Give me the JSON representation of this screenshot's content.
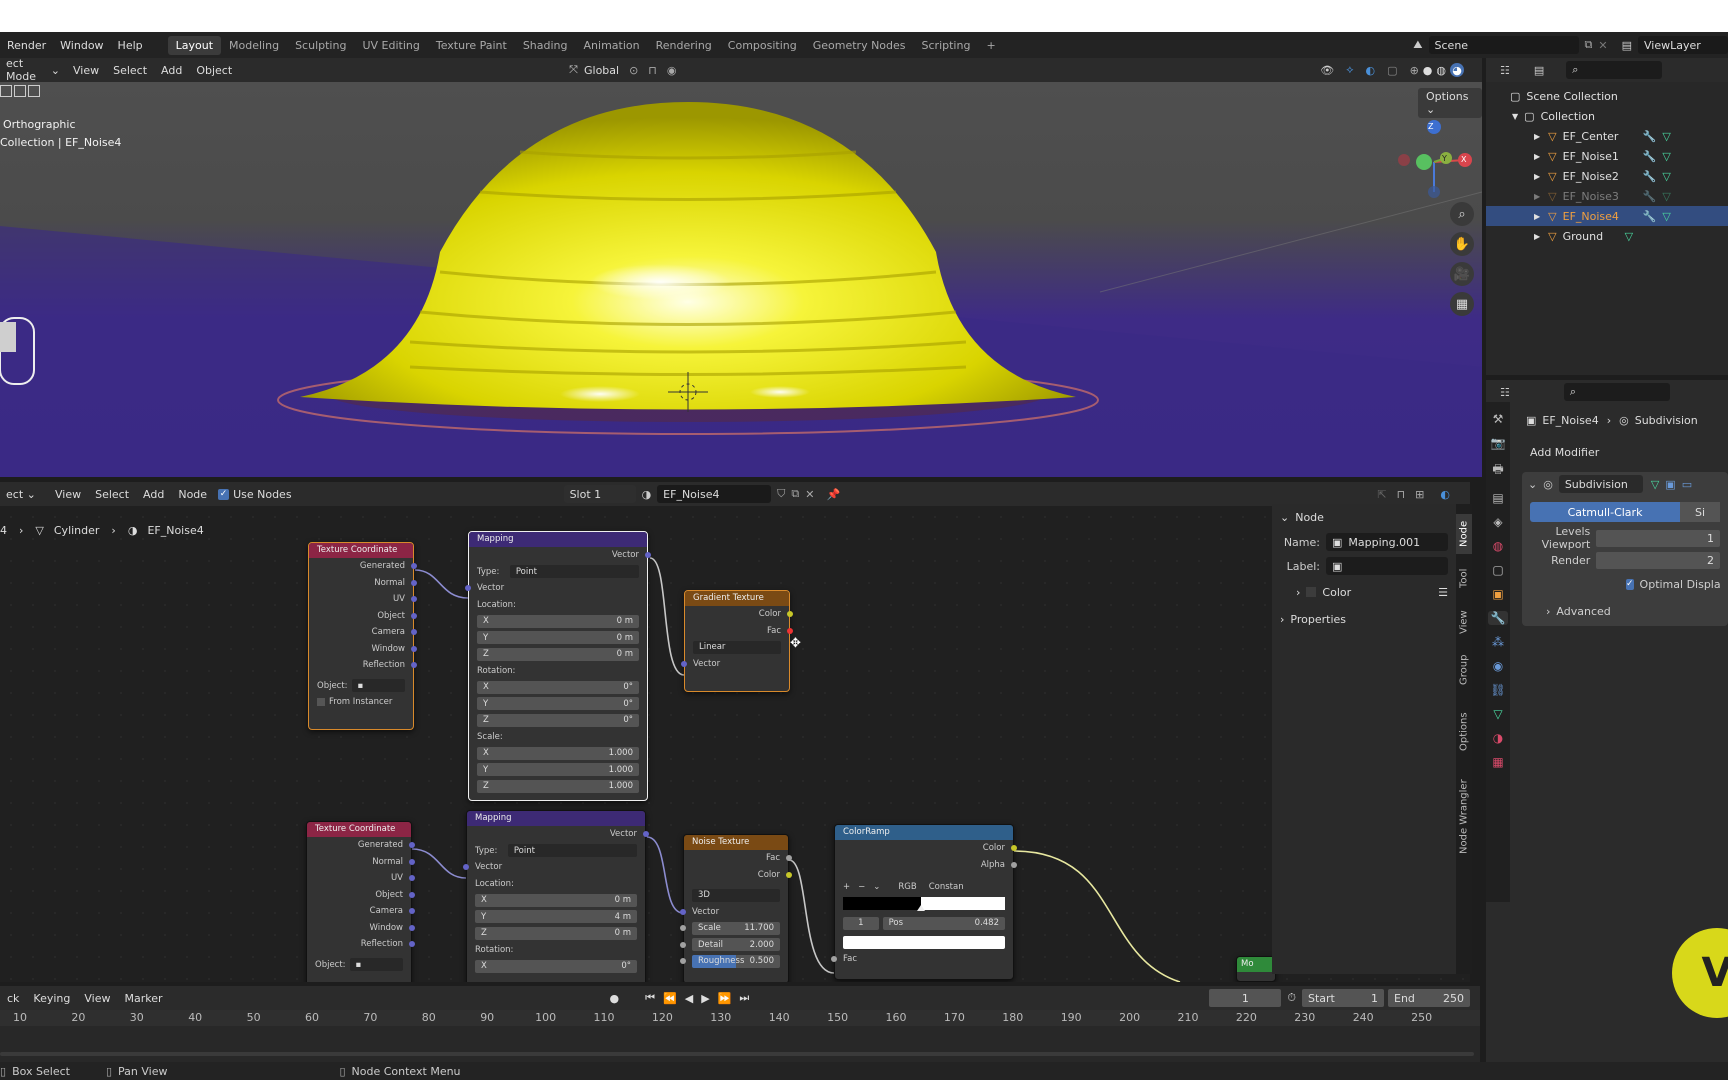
{
  "menu": {
    "items": [
      "Render",
      "Window",
      "Help"
    ],
    "workspaces": [
      "Layout",
      "Modeling",
      "Sculpting",
      "UV Editing",
      "Texture Paint",
      "Shading",
      "Animation",
      "Rendering",
      "Compositing",
      "Geometry Nodes",
      "Scripting"
    ],
    "add_ws": "+",
    "scene": "Scene",
    "view_layer": "ViewLayer"
  },
  "viewport": {
    "mode": "ect Mode",
    "menus": [
      "View",
      "Select",
      "Add",
      "Object"
    ],
    "orientation": "Global",
    "options": "Options",
    "view_name": "Orthographic",
    "collection_label": "Collection | EF_Noise4",
    "gizmo": {
      "z": "Z",
      "y": "Y",
      "x": "X"
    }
  },
  "node_editor": {
    "mode": "ect",
    "menus": [
      "View",
      "Select",
      "Add",
      "Node"
    ],
    "use_nodes": "Use Nodes",
    "slot": "Slot 1",
    "material": "EF_Noise4",
    "breadcrumb": {
      "first": "4",
      "obj": "Cylinder",
      "mat": "EF_Noise4"
    }
  },
  "nodes": {
    "tc1": {
      "title": "Texture Coordinate",
      "outputs": [
        "Generated",
        "Normal",
        "UV",
        "Object",
        "Camera",
        "Window",
        "Reflection"
      ],
      "object_label": "Object:",
      "from_instancer": "From Instancer"
    },
    "map1": {
      "title": "Mapping",
      "out": "Vector",
      "type_label": "Type:",
      "type_val": "Point",
      "vec": "Vector",
      "loc": "Location:",
      "rot": "Rotation:",
      "scale": "Scale:",
      "loc_vals": [
        [
          "X",
          "0 m"
        ],
        [
          "Y",
          "0 m"
        ],
        [
          "Z",
          "0 m"
        ]
      ],
      "rot_vals": [
        [
          "X",
          "0°"
        ],
        [
          "Y",
          "0°"
        ],
        [
          "Z",
          "0°"
        ]
      ],
      "scale_vals": [
        [
          "X",
          "1.000"
        ],
        [
          "Y",
          "1.000"
        ],
        [
          "Z",
          "1.000"
        ]
      ]
    },
    "grad": {
      "title": "Gradient Texture",
      "color": "Color",
      "fac": "Fac",
      "type": "Linear",
      "vec": "Vector"
    },
    "tc2": {
      "title": "Texture Coordinate",
      "outputs": [
        "Generated",
        "Normal",
        "UV",
        "Object",
        "Camera",
        "Window",
        "Reflection"
      ],
      "object_label": "Object:"
    },
    "map2": {
      "title": "Mapping",
      "out": "Vector",
      "type_label": "Type:",
      "type_val": "Point",
      "vec": "Vector",
      "loc": "Location:",
      "rot": "Rotation:",
      "loc_vals": [
        [
          "X",
          "0 m"
        ],
        [
          "Y",
          "4 m"
        ],
        [
          "Z",
          "0 m"
        ]
      ],
      "rot_x": [
        "X",
        "0°"
      ]
    },
    "noise": {
      "title": "Noise Texture",
      "fac": "Fac",
      "color": "Color",
      "dim": "3D",
      "vec": "Vector",
      "scale": [
        "Scale",
        "11.700"
      ],
      "detail": [
        "Detail",
        "2.000"
      ],
      "rough": [
        "Roughness",
        "0.500"
      ]
    },
    "ramp": {
      "title": "ColorRamp",
      "color": "Color",
      "alpha": "Alpha",
      "mode": "RGB",
      "interp": "Constan",
      "index": "1",
      "pos_label": "Pos",
      "pos": "0.482",
      "fac": "Fac",
      "stop_frac": 0.48
    },
    "small": {
      "title": "Mo"
    }
  },
  "npanel": {
    "section": "Node",
    "name_label": "Name:",
    "name_val": "Mapping.001",
    "label_label": "Label:",
    "color": "Color",
    "properties": "Properties",
    "tabs": [
      "Node",
      "Tool",
      "View",
      "Group",
      "Options",
      "Node Wrangler"
    ]
  },
  "outliner": {
    "root": "Scene Collection",
    "collection": "Collection",
    "items": [
      "EF_Center",
      "EF_Noise1",
      "EF_Noise2",
      "EF_Noise3",
      "EF_Noise4",
      "Ground"
    ]
  },
  "properties": {
    "object": "EF_Noise4",
    "modifier_tab": "Subdivision",
    "add_modifier": "Add Modifier",
    "mod_name": "Subdivision",
    "catmull": "Catmull-Clark",
    "simple": "Si",
    "levels_viewport": [
      "Levels Viewport",
      "1"
    ],
    "render": [
      "Render",
      "2"
    ],
    "optimal": "Optimal Displa",
    "advanced": "Advanced"
  },
  "timeline": {
    "menus": [
      "ck",
      "Keying",
      "View",
      "Marker"
    ],
    "frame": "1",
    "start_label": "Start",
    "start": "1",
    "end_label": "End",
    "end": "250",
    "ticks": [
      "10",
      "20",
      "30",
      "40",
      "50",
      "60",
      "70",
      "80",
      "90",
      "100",
      "110",
      "120",
      "130",
      "140",
      "150",
      "160",
      "170",
      "180",
      "190",
      "200",
      "210",
      "220",
      "230",
      "240",
      "250"
    ]
  },
  "status": {
    "box_select": "Box Select",
    "pan_view": "Pan View",
    "context": "Node Context Menu"
  },
  "colors": {
    "accent": "#4772b3",
    "tc_header": "#8c2545",
    "map_header": "#3d2a75",
    "tex_header": "#7a4a14",
    "ramp_header": "#2f5f8a"
  }
}
